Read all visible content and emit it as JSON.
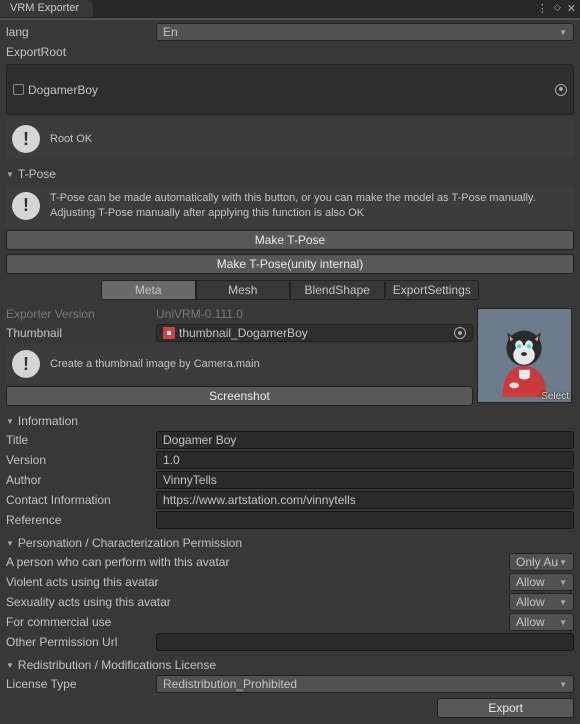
{
  "window": {
    "title": "VRM Exporter"
  },
  "lang": {
    "label": "lang",
    "value": "En"
  },
  "exportRoot": {
    "label": "ExportRoot",
    "object": "DogamerBoy"
  },
  "rootStatus": "Root OK",
  "tpose": {
    "header": "T-Pose",
    "hint": "T-Pose can be made automatically with this button, or you can make the model as T-Pose manually. Adjusting T-Pose manually after applying this function is also OK",
    "btn1": "Make T-Pose",
    "btn2": "Make T-Pose(unity internal)"
  },
  "tabs": {
    "meta": "Meta",
    "mesh": "Mesh",
    "blend": "BlendShape",
    "export": "ExportSettings"
  },
  "exporterVersion": {
    "label": "Exporter Version",
    "value": "UniVRM-0.111.0"
  },
  "thumbnail": {
    "label": "Thumbnail",
    "object": "thumbnail_DogamerBoy",
    "hint": "Create a thumbnail image by Camera.main",
    "btn": "Screenshot",
    "select": "Select"
  },
  "information": {
    "header": "Information",
    "title": {
      "label": "Title",
      "value": "Dogamer Boy"
    },
    "version": {
      "label": "Version",
      "value": "1.0"
    },
    "author": {
      "label": "Author",
      "value": "VinnyTells"
    },
    "contact": {
      "label": "Contact Information",
      "value": "https://www.artstation.com/vinnytells"
    },
    "reference": {
      "label": "Reference",
      "value": ""
    }
  },
  "permission": {
    "header": "Personation / Characterization Permission",
    "perform": {
      "label": "A person who can perform with this avatar",
      "value": "Only Au"
    },
    "violent": {
      "label": "Violent acts using this avatar",
      "value": "Allow"
    },
    "sexual": {
      "label": "Sexuality acts using this avatar",
      "value": "Allow"
    },
    "commercial": {
      "label": "For commercial use",
      "value": "Allow"
    },
    "otherUrl": {
      "label": "Other Permission Url",
      "value": ""
    }
  },
  "license": {
    "header": "Redistribution / Modifications License",
    "type": {
      "label": "License Type",
      "value": "Redistribution_Prohibited"
    }
  },
  "exportBtn": "Export"
}
